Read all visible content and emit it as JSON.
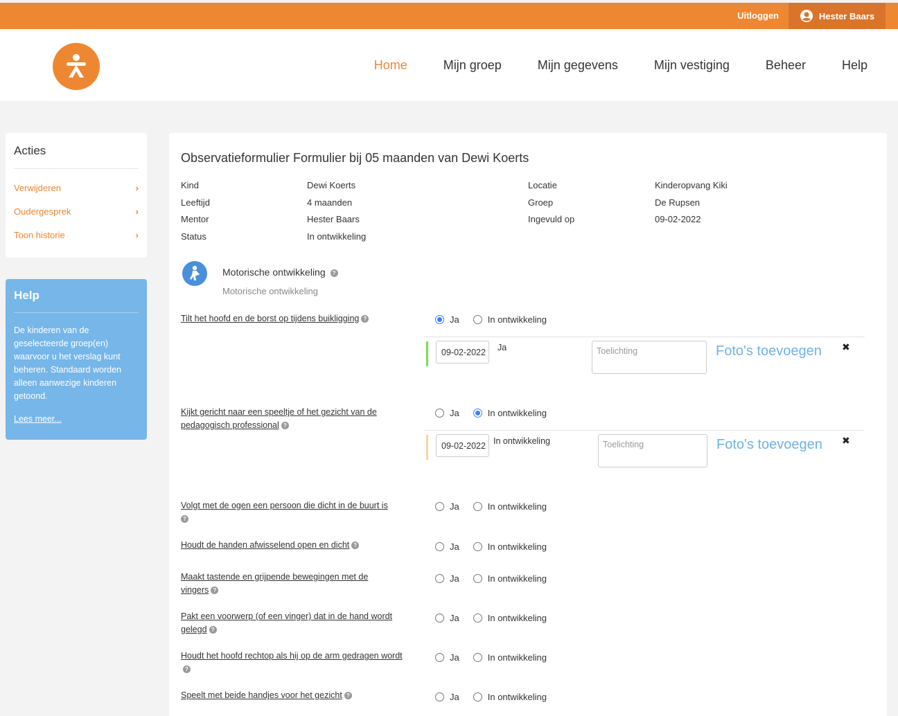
{
  "topbar": {
    "logout": "Uitloggen",
    "user": "Hester Baars"
  },
  "nav": [
    "Home",
    "Mijn groep",
    "Mijn gegevens",
    "Mijn vestiging",
    "Beheer",
    "Help"
  ],
  "acties": {
    "title": "Acties",
    "items": [
      "Verwijderen",
      "Oudergesprek",
      "Toon historie"
    ]
  },
  "help": {
    "title": "Help",
    "text": "De kinderen van de geselecteerde groep(en) waarvoor u het verslag kunt beheren. Standaard worden alleen aanwezige kinderen getoond.",
    "link": "Lees meer..."
  },
  "form": {
    "title": "Observatieformulier Formulier bij 05 maanden van Dewi Koerts",
    "info_left": [
      {
        "label": "Kind",
        "value": "Dewi Koerts"
      },
      {
        "label": "Leeftijd",
        "value": "4 maanden"
      },
      {
        "label": "Mentor",
        "value": "Hester Baars"
      },
      {
        "label": "Status",
        "value": "In ontwikkeling"
      }
    ],
    "info_right": [
      {
        "label": "Locatie",
        "value": "Kinderopvang Kiki"
      },
      {
        "label": "Groep",
        "value": "De Rupsen"
      },
      {
        "label": "Ingevuld op",
        "value": "09-02-2022"
      }
    ],
    "section": {
      "title": "Motorische ontwikkeling",
      "subtitle": "Motorische ontwikkeling"
    },
    "radio_yes": "Ja",
    "radio_dev": "In ontwikkeling",
    "questions": [
      "Tilt het hoofd en de borst op tijdens buikligging",
      "Kijkt gericht naar een speeltje of het gezicht van de pedagogisch professional",
      "Volgt met de ogen een persoon die dicht in de buurt is",
      "Houdt de handen afwisselend open en dicht",
      "Maakt tastende en grijpende bewegingen met de vingers",
      "Pakt een voorwerp (of een vinger) dat in de hand wordt gelegd",
      "Houdt het hoofd rechtop als hij op de arm gedragen wordt",
      "Speelt met beide handjes voor het gezicht"
    ],
    "observations": [
      {
        "date": "09-02-2022",
        "value": "Ja",
        "placeholder": "Toelichting",
        "photos": "Foto's toevoegen",
        "color": "#7ed957"
      },
      {
        "date": "09-02-2022",
        "value": "In ontwikkeling",
        "placeholder": "Toelichting",
        "photos": "Foto's toevoegen",
        "color": "#f5d9a3"
      }
    ]
  }
}
